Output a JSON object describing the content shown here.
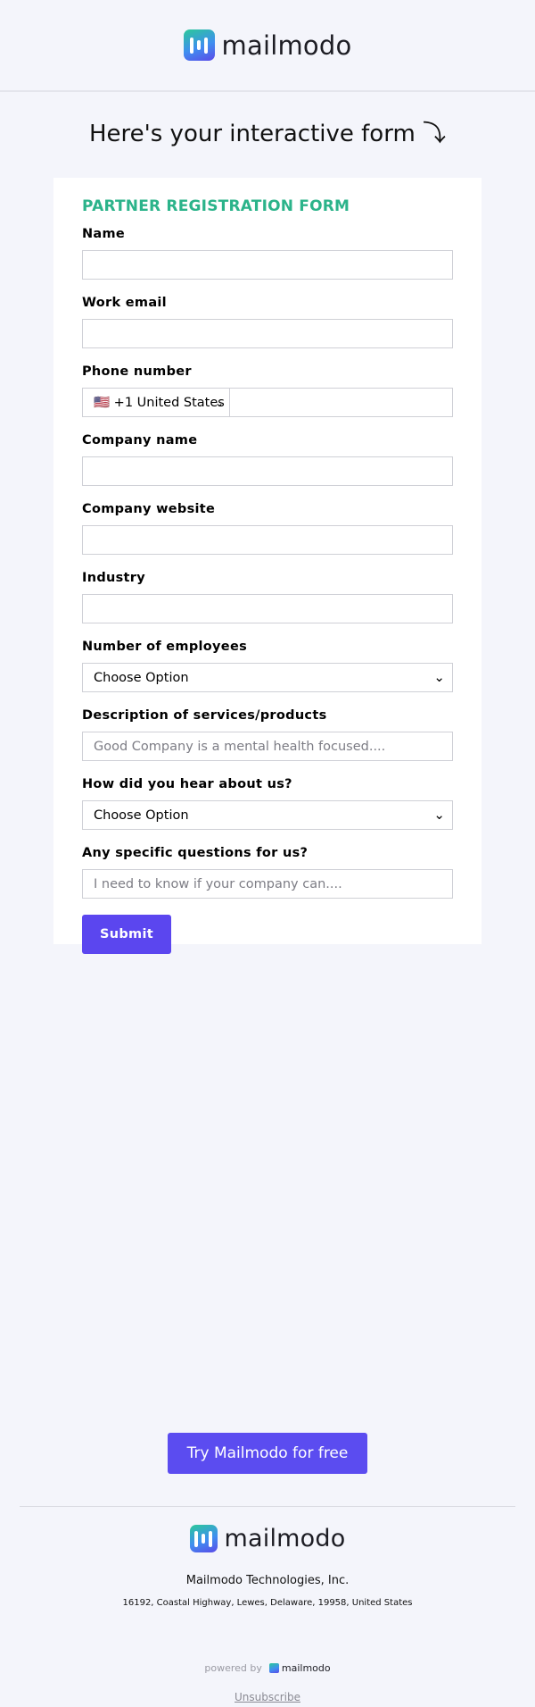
{
  "header": {
    "brand": "mailmodo"
  },
  "headline": "Here's your interactive form ⤵",
  "form": {
    "title": "PARTNER REGISTRATION FORM",
    "name_label": "Name",
    "email_label": "Work email",
    "phone_label": "Phone number",
    "phone_country": "🇺🇸 +1 United States",
    "company_label": "Company name",
    "website_label": "Company website",
    "industry_label": "Industry",
    "employees_label": "Number of employees",
    "employees_value": "Choose Option",
    "description_label": "Description of services/products",
    "description_placeholder": "Good Company is a mental health focused....",
    "hear_label": "How did you hear about us?",
    "hear_value": "Choose Option",
    "questions_label": "Any specific questions for us?",
    "questions_placeholder": "I need to know if your company can....",
    "submit_label": "Submit"
  },
  "cta_label": "Try Mailmodo for free",
  "footer": {
    "brand": "mailmodo",
    "company": "Mailmodo Technologies, Inc.",
    "address": "16192, Coastal Highway, Lewes, Delaware, 19958, United States",
    "powered_by": "powered by",
    "powered_brand": "mailmodo",
    "unsubscribe": "Unsubscribe"
  },
  "colors": {
    "accent": "#5b46ef",
    "title_green": "#2bb38a",
    "background": "#f4f5fb"
  }
}
